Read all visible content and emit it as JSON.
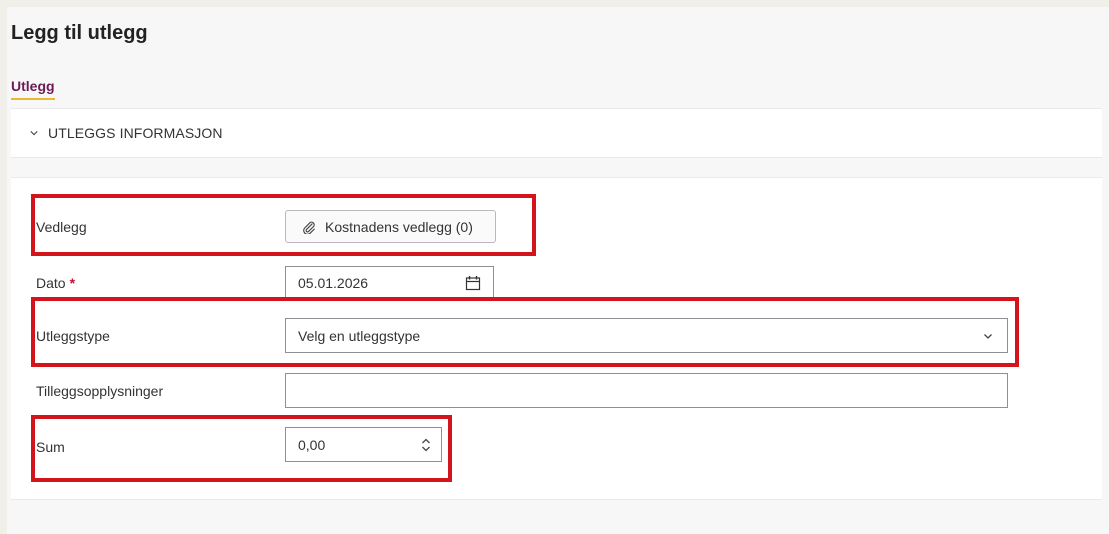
{
  "page": {
    "title": "Legg til utlegg"
  },
  "tabs": [
    {
      "label": "Utlegg",
      "active": true
    }
  ],
  "section": {
    "title": "UTLEGGS INFORMASJON",
    "expanded": true
  },
  "form": {
    "attachment": {
      "label": "Vedlegg",
      "button_label": "Kostnadens vedlegg (0)"
    },
    "date": {
      "label": "Dato",
      "required_marker": "*",
      "value": "05.01.2026"
    },
    "expense_type": {
      "label": "Utleggstype",
      "value": "Velg en utleggstype"
    },
    "additional_info": {
      "label": "Tilleggsopplysninger",
      "value": ""
    },
    "sum": {
      "label": "Sum",
      "value": "0,00"
    }
  },
  "icons": {
    "section_toggle": "chevron-down-icon",
    "attachment": "paperclip-icon",
    "date": "calendar-icon",
    "select": "chevron-down-icon",
    "sum": "spinner-arrows-icon"
  },
  "colors": {
    "active_tab_text": "#6b1a55",
    "active_tab_underline": "#e9b730",
    "required_marker": "#c0133a",
    "highlight_box": "#d3141b"
  }
}
